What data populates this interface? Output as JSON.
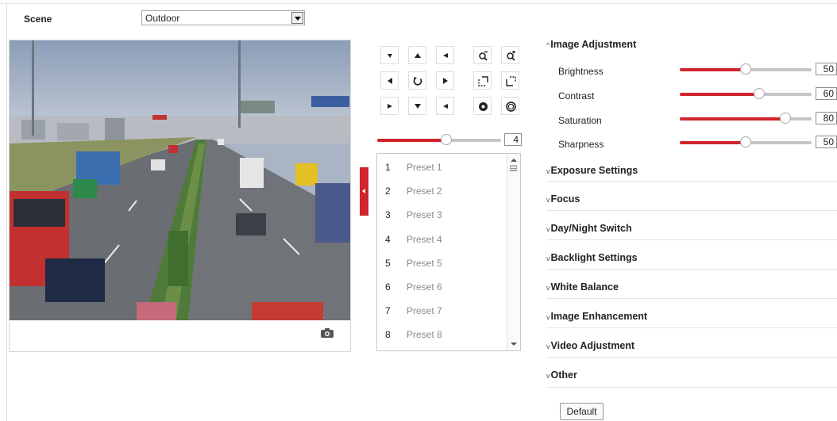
{
  "scene": {
    "label": "Scene",
    "value": "Outdoor"
  },
  "ptz": {
    "speed": {
      "value": "4",
      "level": 0.56
    },
    "presets": [
      {
        "num": "1",
        "name": "Preset 1"
      },
      {
        "num": "2",
        "name": "Preset 2"
      },
      {
        "num": "3",
        "name": "Preset 3"
      },
      {
        "num": "4",
        "name": "Preset 4"
      },
      {
        "num": "5",
        "name": "Preset 5"
      },
      {
        "num": "6",
        "name": "Preset 6"
      },
      {
        "num": "7",
        "name": "Preset 7"
      },
      {
        "num": "8",
        "name": "Preset 8"
      }
    ]
  },
  "image_adjustment": {
    "title": "Image Adjustment",
    "brightness": {
      "label": "Brightness",
      "value": "50",
      "level": 0.5
    },
    "contrast": {
      "label": "Contrast",
      "value": "60",
      "level": 0.6
    },
    "saturation": {
      "label": "Saturation",
      "value": "80",
      "level": 0.8
    },
    "sharpness": {
      "label": "Sharpness",
      "value": "50",
      "level": 0.5
    }
  },
  "sections": {
    "exposure": "Exposure Settings",
    "focus": "Focus",
    "day_night": "Day/Night Switch",
    "backlight": "Backlight Settings",
    "white_balance": "White Balance",
    "enhancement": "Image Enhancement",
    "video_adjustment": "Video Adjustment",
    "other": "Other"
  },
  "default_button": "Default",
  "colors": {
    "accent": "#d0252e",
    "track": "#c5c5c5"
  },
  "icons": [
    "dropdown-arrow-icon",
    "camera-snapshot-icon",
    "pan-arrow-icon",
    "zoom-in-icon",
    "zoom-out-icon",
    "focus-icon",
    "iris-icon",
    "auto-pan-icon",
    "collapse-icon",
    "chevron-up-icon",
    "chevron-down-icon"
  ]
}
